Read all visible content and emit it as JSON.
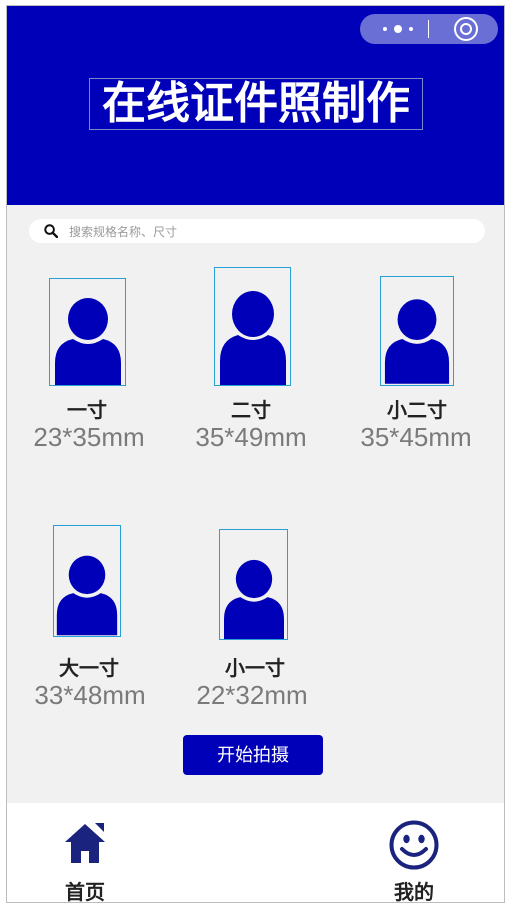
{
  "header": {
    "title": "在线证件照制作"
  },
  "capsule": {
    "menu_icon": "more-dots-icon",
    "close_icon": "target-icon"
  },
  "search": {
    "placeholder": "搜索规格名称、尺寸",
    "icon": "search-icon"
  },
  "items": [
    {
      "name": "一寸",
      "size": "23*35mm"
    },
    {
      "name": "二寸",
      "size": "35*49mm"
    },
    {
      "name": "小二寸",
      "size": "35*45mm"
    },
    {
      "name": "大一寸",
      "size": "33*48mm"
    },
    {
      "name": "小一寸",
      "size": "22*32mm"
    }
  ],
  "start_button": {
    "label": "开始拍摄"
  },
  "tabbar": {
    "tabs": [
      {
        "label": "首页",
        "icon": "home-icon"
      },
      {
        "label": "我的",
        "icon": "smiley-icon"
      }
    ]
  },
  "colors": {
    "primary": "#0000b8",
    "tab_icon": "#1a237e",
    "background": "#f1f1f1",
    "photo_border": "#2a9fd6"
  }
}
